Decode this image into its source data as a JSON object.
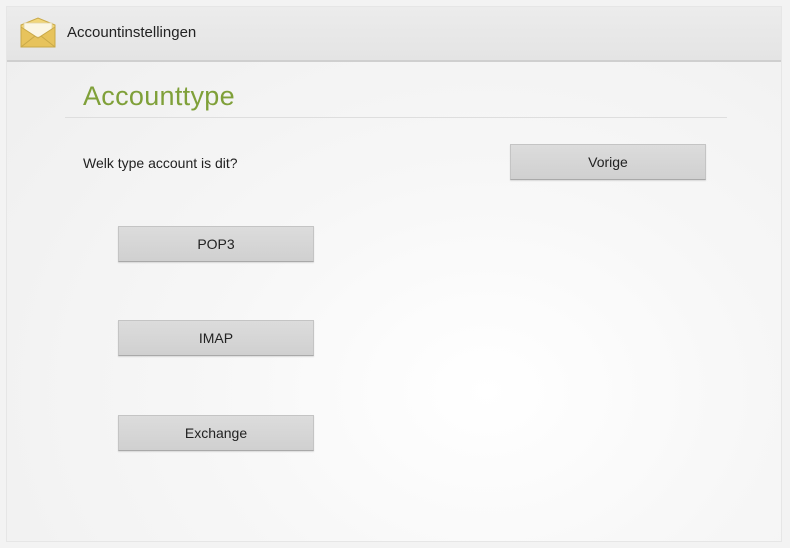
{
  "action_bar": {
    "title": "Accountinstellingen",
    "icon": "email-app-icon"
  },
  "page": {
    "section_title": "Accounttype",
    "question": "Welk type account is dit?",
    "back_label": "Vorige"
  },
  "account_types": {
    "pop3": "POP3",
    "imap": "IMAP",
    "exchange": "Exchange"
  },
  "colors": {
    "accent": "#7fa039",
    "button": "#d6d6d6",
    "background": "#f3f3f3"
  }
}
